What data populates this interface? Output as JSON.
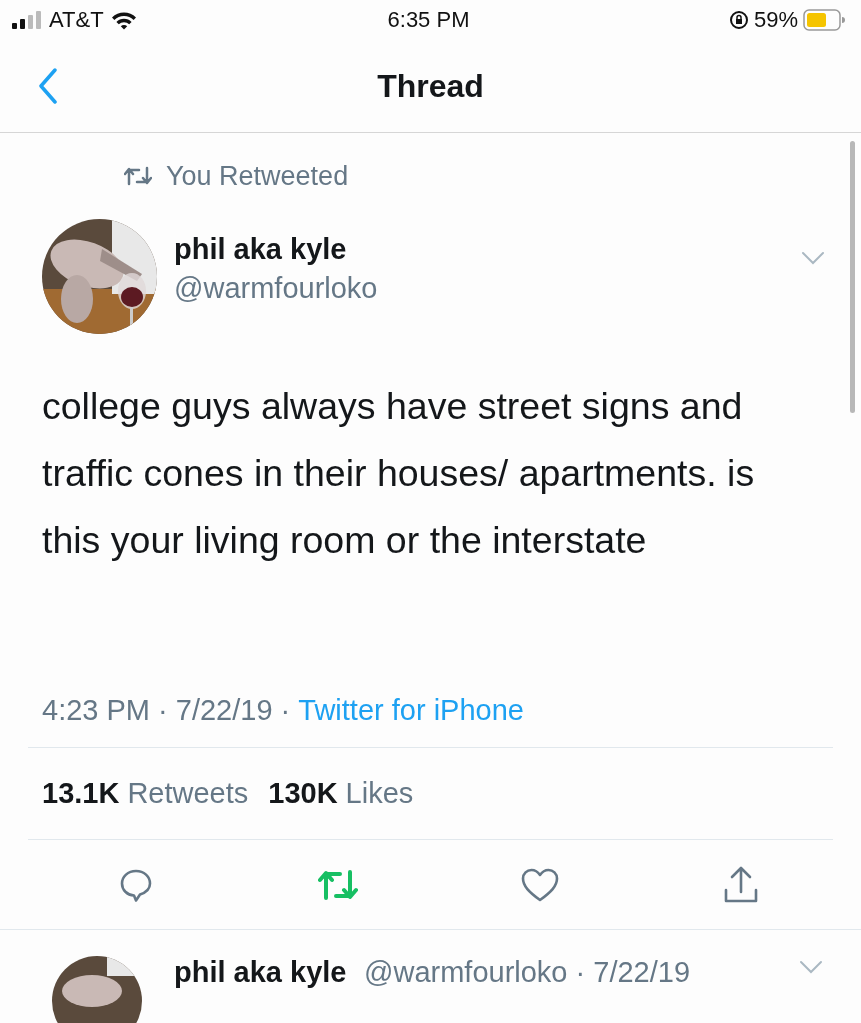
{
  "status_bar": {
    "carrier": "AT&T",
    "time": "6:35 PM",
    "battery": "59%"
  },
  "nav": {
    "title": "Thread"
  },
  "tweet": {
    "retweet_label": "You Retweeted",
    "name": "phil aka kyle",
    "handle": "@warmfourloko",
    "text": "college guys always have street signs and traffic cones in their houses/ apartments. is this your living room or the interstate",
    "time": "4:23 PM · 7/22/19 · ",
    "source": "Twitter for iPhone",
    "stats": [
      {
        "count": "13.1K",
        "label": "Retweets"
      },
      {
        "count": "130K",
        "label": "Likes"
      }
    ],
    "actions": [
      {
        "kind": "reply",
        "on": false
      },
      {
        "kind": "retweet",
        "on": true
      },
      {
        "kind": "like",
        "on": false
      },
      {
        "kind": "share",
        "on": false
      }
    ]
  },
  "next_tweet": {
    "name": "phil aka kyle",
    "meta": "@warmfourloko · 7/22/19"
  }
}
